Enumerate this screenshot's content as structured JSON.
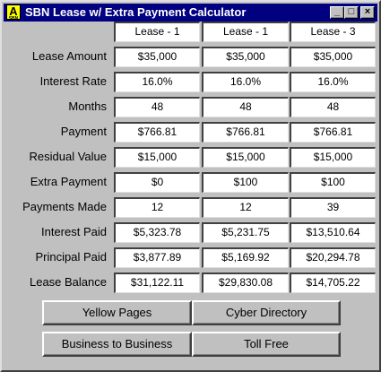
{
  "window": {
    "title": "SBN Lease w/ Extra Payment Calculator",
    "icon_text": "A",
    "icon_sub": "SBN",
    "controls": {
      "minimize": "_",
      "maximize": "□",
      "close": "×"
    }
  },
  "columns": [
    "Lease - 1",
    "Lease - 1",
    "Lease - 3"
  ],
  "rows": [
    {
      "label": "Lease Amount",
      "values": [
        "$35,000",
        "$35,000",
        "$35,000"
      ]
    },
    {
      "label": "Interest Rate",
      "values": [
        "16.0%",
        "16.0%",
        "16.0%"
      ]
    },
    {
      "label": "Months",
      "values": [
        "48",
        "48",
        "48"
      ]
    },
    {
      "label": "Payment",
      "values": [
        "$766.81",
        "$766.81",
        "$766.81"
      ]
    },
    {
      "label": "Residual Value",
      "values": [
        "$15,000",
        "$15,000",
        "$15,000"
      ]
    },
    {
      "label": "Extra Payment",
      "values": [
        "$0",
        "$100",
        "$100"
      ]
    },
    {
      "label": "Payments Made",
      "values": [
        "12",
        "12",
        "39"
      ]
    },
    {
      "label": "Interest Paid",
      "values": [
        "$5,323.78",
        "$5,231.75",
        "$13,510.64"
      ]
    },
    {
      "label": "Principal Paid",
      "values": [
        "$3,877.89",
        "$5,169.92",
        "$20,294.78"
      ]
    },
    {
      "label": "Lease Balance",
      "values": [
        "$31,122.11",
        "$29,830.08",
        "$14,705.22"
      ]
    }
  ],
  "buttons": {
    "yellow_pages": "Yellow Pages",
    "cyber_directory": "Cyber Directory",
    "business_to_business": "Business to Business",
    "toll_free": "Toll Free"
  }
}
